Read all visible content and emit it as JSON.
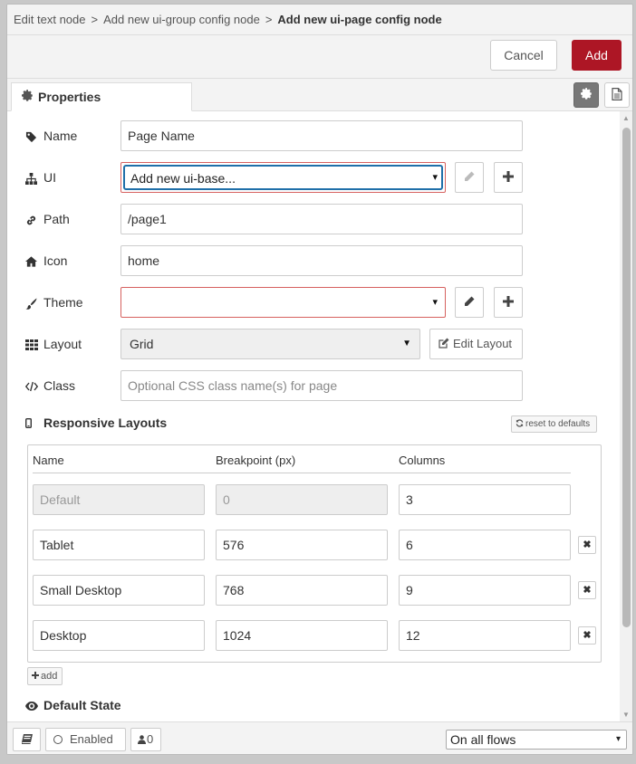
{
  "breadcrumbs": [
    "Edit text node",
    "Add new ui-group config node",
    "Add new ui-page config node"
  ],
  "toolbar": {
    "cancel_label": "Cancel",
    "add_label": "Add"
  },
  "tabs": {
    "properties_label": "Properties"
  },
  "form": {
    "name": {
      "label": "Name",
      "value": "Page Name"
    },
    "ui": {
      "label": "UI",
      "value": "Add new ui-base..."
    },
    "path": {
      "label": "Path",
      "value": "/page1"
    },
    "icon": {
      "label": "Icon",
      "value": "home"
    },
    "theme": {
      "label": "Theme",
      "value": ""
    },
    "layout": {
      "label": "Layout",
      "value": "Grid",
      "edit_label": "Edit Layout"
    },
    "class": {
      "label": "Class",
      "placeholder": "Optional CSS class name(s) for page"
    }
  },
  "responsive": {
    "title": "Responsive Layouts",
    "reset_label": "reset to defaults",
    "columns": [
      "Name",
      "Breakpoint (px)",
      "Columns"
    ],
    "rows": [
      {
        "name": "Default",
        "breakpoint": "0",
        "columns": "3",
        "disabled": true
      },
      {
        "name": "Tablet",
        "breakpoint": "576",
        "columns": "6",
        "disabled": false
      },
      {
        "name": "Small Desktop",
        "breakpoint": "768",
        "columns": "9",
        "disabled": false
      },
      {
        "name": "Desktop",
        "breakpoint": "1024",
        "columns": "12",
        "disabled": false
      }
    ],
    "add_label": "add"
  },
  "default_state": {
    "title": "Default State"
  },
  "footer": {
    "enabled_label": "Enabled",
    "users_count": "0",
    "flow_scope": "On all flows"
  },
  "colors": {
    "primary": "#ad1625",
    "focus": "#1f6fa9",
    "error_border": "#d6615f"
  }
}
